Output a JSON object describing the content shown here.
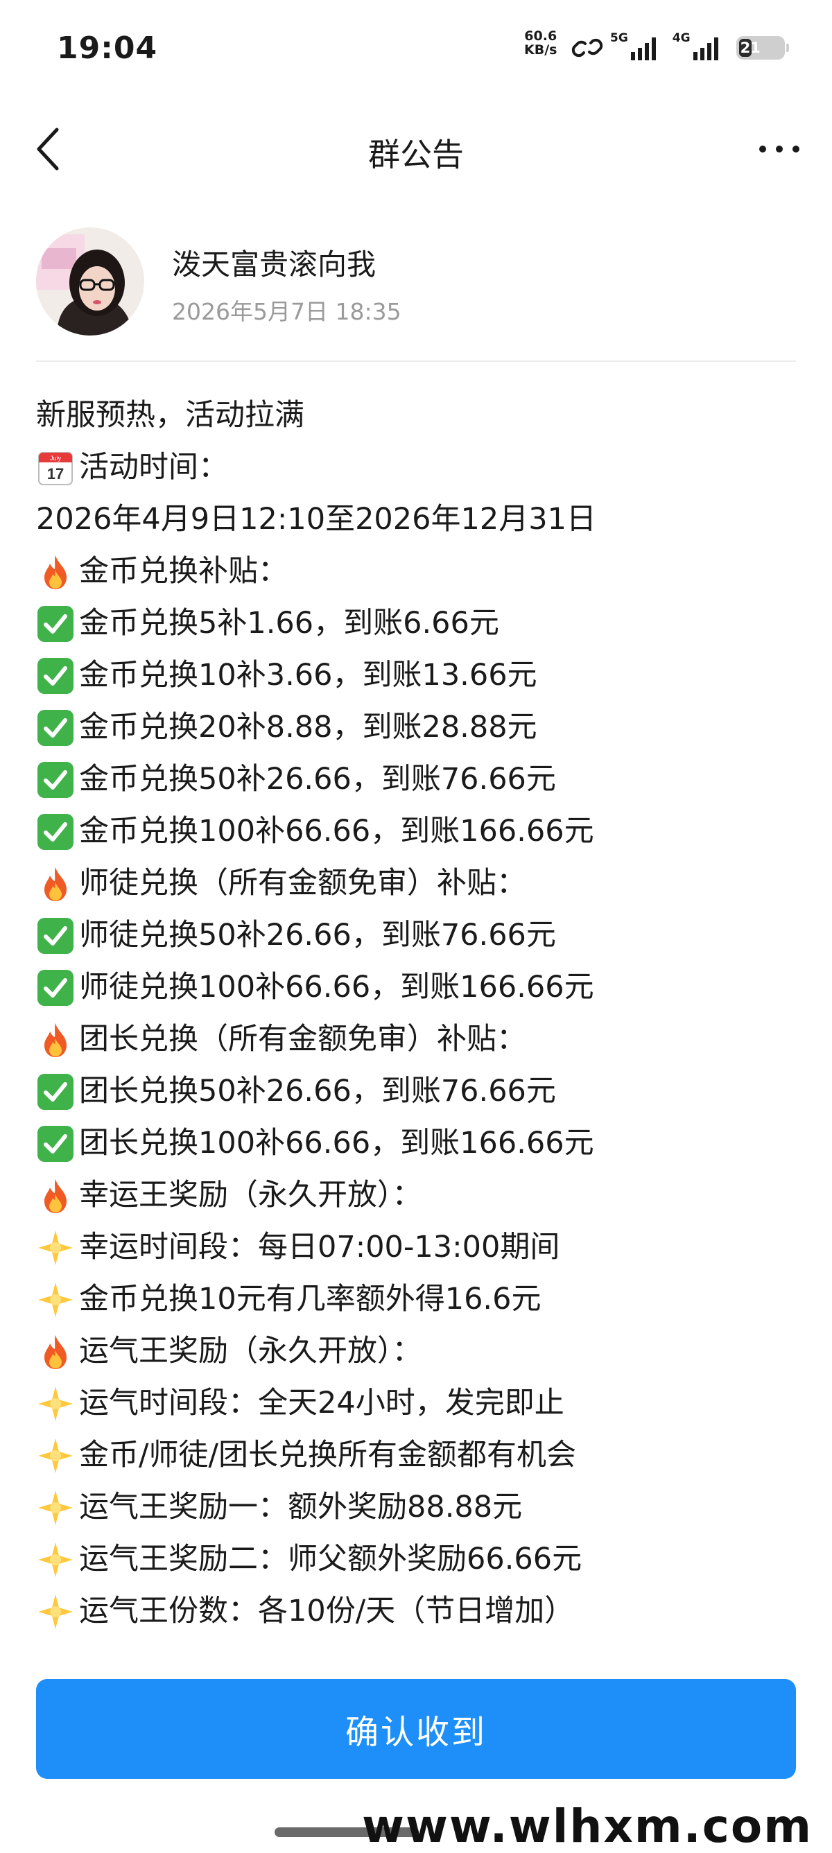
{
  "status": {
    "time": "19:04",
    "netspeed_value": "60.6",
    "netspeed_unit": "KB/s",
    "signal1_label": "5G",
    "signal2_label": "4G",
    "battery": "21"
  },
  "nav": {
    "title": "群公告"
  },
  "author": {
    "name": "泼天富贵滚向我",
    "date": "2026年5月7日 18:35"
  },
  "announcement": {
    "lines": [
      {
        "icon": "none",
        "text": "新服预热，活动拉满"
      },
      {
        "icon": "calendar-icon",
        "text": "活动时间："
      },
      {
        "icon": "none",
        "text": "2026年4月9日12:10至2026年12月31日"
      },
      {
        "icon": "fire-icon",
        "text": "金币兑换补贴："
      },
      {
        "icon": "check-icon",
        "text": "金币兑换5补1.66，到账6.66元"
      },
      {
        "icon": "check-icon",
        "text": "金币兑换10补3.66，到账13.66元"
      },
      {
        "icon": "check-icon",
        "text": "金币兑换20补8.88，到账28.88元"
      },
      {
        "icon": "check-icon",
        "text": "金币兑换50补26.66，到账76.66元"
      },
      {
        "icon": "check-icon",
        "text": "金币兑换100补66.66，到账166.66元"
      },
      {
        "icon": "fire-icon",
        "text": "师徒兑换（所有金额免审）补贴："
      },
      {
        "icon": "check-icon",
        "text": "师徒兑换50补26.66，到账76.66元"
      },
      {
        "icon": "check-icon",
        "text": "师徒兑换100补66.66，到账166.66元"
      },
      {
        "icon": "fire-icon",
        "text": "团长兑换（所有金额免审）补贴："
      },
      {
        "icon": "check-icon",
        "text": "团长兑换50补26.66，到账76.66元"
      },
      {
        "icon": "check-icon",
        "text": "团长兑换100补66.66，到账166.66元"
      },
      {
        "icon": "fire-icon",
        "text": "幸运王奖励（永久开放）："
      },
      {
        "icon": "star-icon",
        "text": "幸运时间段：每日07:00-13:00期间"
      },
      {
        "icon": "star-icon",
        "text": "金币兑换10元有几率额外得16.6元"
      },
      {
        "icon": "fire-icon",
        "text": "运气王奖励（永久开放）："
      },
      {
        "icon": "star-icon",
        "text": "运气时间段：全天24小时，发完即止"
      },
      {
        "icon": "star-icon",
        "text": "金币/师徒/团长兑换所有金额都有机会"
      },
      {
        "icon": "star-icon",
        "text": "运气王奖励一：额外奖励88.88元"
      },
      {
        "icon": "star-icon",
        "text": "运气王奖励二：师父额外奖励66.66元"
      },
      {
        "icon": "star-icon",
        "text": "运气王份数：各10份/天（节日增加）"
      }
    ]
  },
  "confirm_button": "确认收到",
  "watermark": "www.wlhxm.com",
  "colors": {
    "accent": "#1e8ff9",
    "check": "#3fb24a",
    "fire": "#f05a24",
    "star": "#ffc83d"
  }
}
